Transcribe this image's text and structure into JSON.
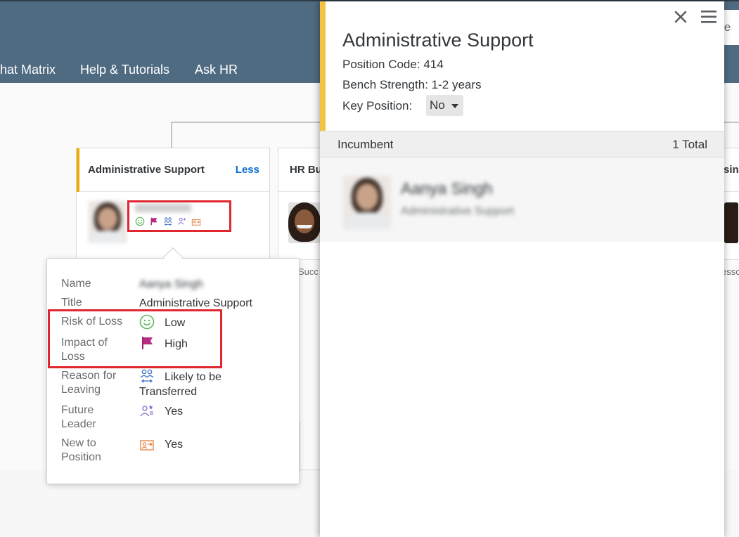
{
  "nav": {
    "items": [
      "hat Matrix",
      "Help & Tutorials",
      "Ask HR"
    ]
  },
  "search": {
    "partial_text": "le"
  },
  "org": {
    "card_main": {
      "title": "Administrative Support",
      "toggle": "Less",
      "person_name_blurred": "Aanya Singh"
    },
    "card_second": {
      "title_partial": "HR Bu",
      "footer_partial": "Succ"
    },
    "card_third": {
      "title_partial": "sin",
      "footer_partial": "esso"
    }
  },
  "popover": {
    "rows": [
      {
        "label": "Name",
        "value": "Aanya Singh"
      },
      {
        "label": "Title",
        "value": "Administrative Support"
      },
      {
        "label": "Risk of Loss",
        "value": "Low",
        "icon": "smiley-icon"
      },
      {
        "label": "Impact of Loss",
        "value": "High",
        "icon": "flag-icon"
      },
      {
        "label": "Reason for Leaving",
        "value": "Likely to be Transferred",
        "icon": "transfer-people-icon"
      },
      {
        "label": "Future Leader",
        "value": "Yes",
        "icon": "future-leader-icon"
      },
      {
        "label": "New to Position",
        "value": "Yes",
        "icon": "new-position-icon"
      }
    ]
  },
  "panel": {
    "title": "Administrative Support",
    "position_code_label": "Position Code:",
    "position_code": "414",
    "bench_label": "Bench Strength:",
    "bench_value": "1-2 years",
    "key_label": "Key Position:",
    "key_value": "No",
    "section_title": "Incumbent",
    "section_count": "1 Total",
    "incumbent_name": "Aanya Singh",
    "incumbent_title": "Administrative Support"
  },
  "colors": {
    "header": "#4f6b82",
    "accent": "#f0ab00",
    "highlight": "#e0262f",
    "link": "#0a6ed1"
  }
}
